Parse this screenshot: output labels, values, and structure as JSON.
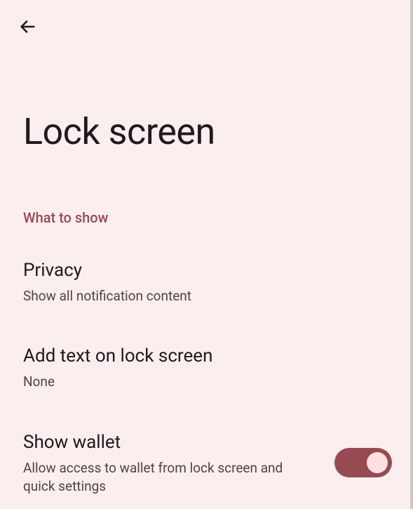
{
  "header": {
    "title": "Lock screen"
  },
  "section": {
    "header": "What to show"
  },
  "settings": {
    "privacy": {
      "title": "Privacy",
      "subtitle": "Show all notification content"
    },
    "add_text": {
      "title": "Add text on lock screen",
      "subtitle": "None"
    },
    "show_wallet": {
      "title": "Show wallet",
      "subtitle": "Allow access to wallet from lock screen and quick settings",
      "enabled": true
    }
  }
}
